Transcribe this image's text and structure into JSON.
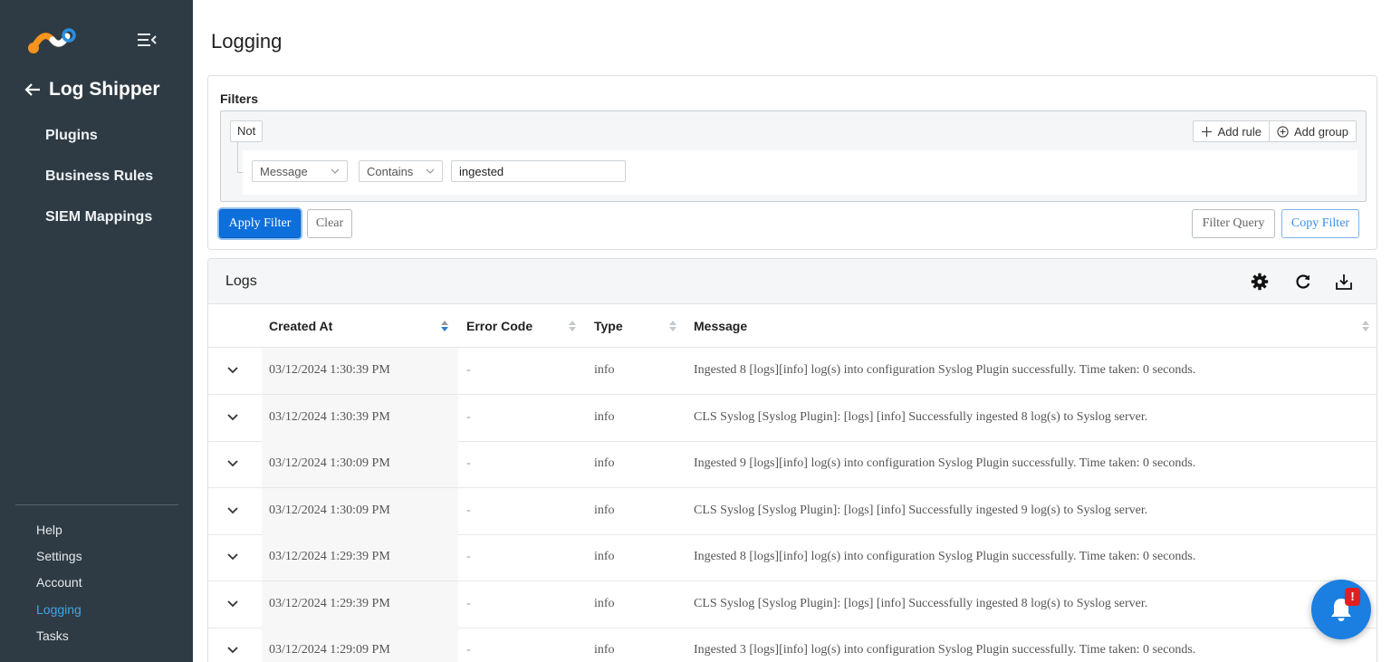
{
  "sidebar": {
    "back_label": "Log Shipper",
    "items": [
      {
        "label": "Plugins"
      },
      {
        "label": "Business Rules"
      },
      {
        "label": "SIEM Mappings"
      }
    ],
    "bottom_items": [
      {
        "label": "Help",
        "active": false
      },
      {
        "label": "Settings",
        "active": false
      },
      {
        "label": "Account",
        "active": false
      },
      {
        "label": "Logging",
        "active": true
      },
      {
        "label": "Tasks",
        "active": false
      }
    ]
  },
  "page": {
    "title": "Logging"
  },
  "filters": {
    "label": "Filters",
    "not_label": "Not",
    "add_rule_label": "Add rule",
    "add_group_label": "Add group",
    "rule": {
      "field": "Message",
      "operator": "Contains",
      "value": "ingested"
    },
    "apply_label": "Apply Filter",
    "clear_label": "Clear",
    "filter_query_label": "Filter Query",
    "copy_filter_label": "Copy Filter"
  },
  "logs": {
    "title": "Logs",
    "columns": [
      "Created At",
      "Error Code",
      "Type",
      "Message"
    ],
    "rows": [
      {
        "created": "03/12/2024 1:30:39 PM",
        "code": "-",
        "type": "info",
        "message": "Ingested 8 [logs][info] log(s) into configuration Syslog Plugin successfully. Time taken: 0 seconds."
      },
      {
        "created": "03/12/2024 1:30:39 PM",
        "code": "-",
        "type": "info",
        "message": "CLS Syslog [Syslog Plugin]: [logs] [info] Successfully ingested 8 log(s) to Syslog server."
      },
      {
        "created": "03/12/2024 1:30:09 PM",
        "code": "-",
        "type": "info",
        "message": "Ingested 9 [logs][info] log(s) into configuration Syslog Plugin successfully. Time taken: 0 seconds."
      },
      {
        "created": "03/12/2024 1:30:09 PM",
        "code": "-",
        "type": "info",
        "message": "CLS Syslog [Syslog Plugin]: [logs] [info] Successfully ingested 9 log(s) to Syslog server."
      },
      {
        "created": "03/12/2024 1:29:39 PM",
        "code": "-",
        "type": "info",
        "message": "Ingested 8 [logs][info] log(s) into configuration Syslog Plugin successfully. Time taken: 0 seconds."
      },
      {
        "created": "03/12/2024 1:29:39 PM",
        "code": "-",
        "type": "info",
        "message": "CLS Syslog [Syslog Plugin]: [logs] [info] Successfully ingested 8 log(s) to Syslog server."
      },
      {
        "created": "03/12/2024 1:29:09 PM",
        "code": "-",
        "type": "info",
        "message": "Ingested 3 [logs][info] log(s) into configuration Syslog Plugin successfully. Time taken: 0 seconds."
      }
    ]
  },
  "notification": {
    "badge": "!"
  },
  "colors": {
    "sidebar_bg": "#2f3b44",
    "primary": "#0d6fdc",
    "active_link": "#3aa8e8",
    "fab": "#1a7fe0",
    "badge": "#e02020"
  }
}
